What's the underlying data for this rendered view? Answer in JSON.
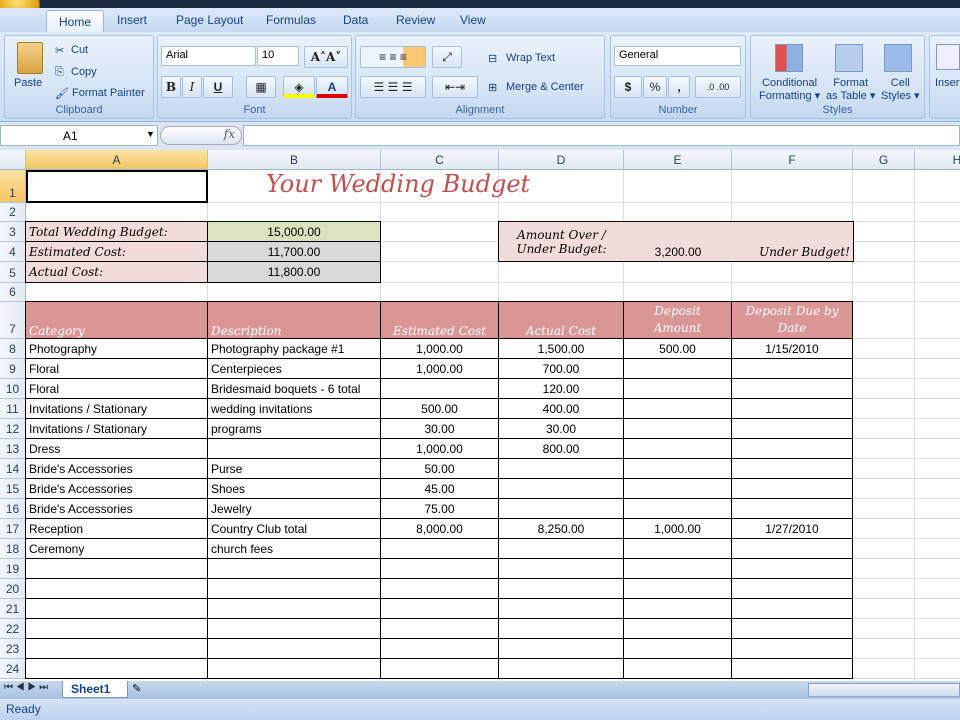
{
  "ribbon": {
    "tabs": [
      "Home",
      "Insert",
      "Page Layout",
      "Formulas",
      "Data",
      "Review",
      "View"
    ],
    "active_tab": "Home",
    "clipboard": {
      "paste": "Paste",
      "cut": "Cut",
      "copy": "Copy",
      "format_painter": "Format Painter",
      "label": "Clipboard"
    },
    "font": {
      "name": "Arial",
      "size": "10",
      "bold": "B",
      "italic": "I",
      "underline": "U",
      "label": "Font",
      "fill_color": "#ffff00",
      "font_color": "#e00000"
    },
    "alignment": {
      "wrap_text": "Wrap Text",
      "merge_center": "Merge & Center",
      "label": "Alignment"
    },
    "number": {
      "format": "General",
      "currency": "$",
      "percent": "%",
      "comma": ",",
      "label": "Number"
    },
    "styles": {
      "conditional": "Conditional",
      "conditional2": "Formatting",
      "format_table": "Format",
      "format_table2": "as Table",
      "cell_styles": "Cell",
      "cell_styles2": "Styles",
      "label": "Styles"
    },
    "cells": {
      "insert": "Insert"
    }
  },
  "formula_bar": {
    "name_box": "A1",
    "fx": "fx",
    "value": ""
  },
  "columns": [
    "A",
    "B",
    "C",
    "D",
    "E",
    "F",
    "G",
    "H"
  ],
  "selected_cell": "A1",
  "sheet": {
    "title": "Your Wedding Budget",
    "summary": [
      {
        "label": "Total Wedding Budget:",
        "value": "15,000.00"
      },
      {
        "label": "Estimated Cost:",
        "value": "11,700.00"
      },
      {
        "label": "Actual Cost:",
        "value": "11,800.00"
      }
    ],
    "over_under": {
      "label1": "Amount Over /",
      "label2": "Under Budget:",
      "value": "3,200.00",
      "status": "Under Budget!"
    },
    "headers": [
      "Category",
      "Description",
      "Estimated Cost",
      "Actual Cost",
      "Deposit Amount",
      "Deposit Due by Date"
    ],
    "headers_split": {
      "e1": "Deposit",
      "e2": "Amount",
      "f1": "Deposit Due by",
      "f2": "Date"
    },
    "rows": [
      [
        "Photography",
        "Photography package #1",
        "1,000.00",
        "1,500.00",
        "500.00",
        "1/15/2010"
      ],
      [
        "Floral",
        "Centerpieces",
        "1,000.00",
        "700.00",
        "",
        ""
      ],
      [
        "Floral",
        "Bridesmaid boquets - 6 total",
        "",
        "120.00",
        "",
        ""
      ],
      [
        "Invitations / Stationary",
        "wedding invitations",
        "500.00",
        "400.00",
        "",
        ""
      ],
      [
        "Invitations / Stationary",
        "programs",
        "30.00",
        "30.00",
        "",
        ""
      ],
      [
        "Dress",
        "",
        "1,000.00",
        "800.00",
        "",
        ""
      ],
      [
        "Bride's Accessories",
        "Purse",
        "50.00",
        "",
        "",
        ""
      ],
      [
        "Bride's Accessories",
        "Shoes",
        "45.00",
        "",
        "",
        ""
      ],
      [
        "Bride's Accessories",
        "Jewelry",
        "75.00",
        "",
        "",
        ""
      ],
      [
        "Reception",
        "Country Club total",
        "8,000.00",
        "8,250.00",
        "1,000.00",
        "1/27/2010"
      ],
      [
        "Ceremony",
        "church fees",
        "",
        "",
        "",
        ""
      ],
      [
        "",
        "",
        "",
        "",
        "",
        ""
      ],
      [
        "",
        "",
        "",
        "",
        "",
        ""
      ],
      [
        "",
        "",
        "",
        "",
        "",
        ""
      ],
      [
        "",
        "",
        "",
        "",
        "",
        ""
      ],
      [
        "",
        "",
        "",
        "",
        "",
        ""
      ],
      [
        "",
        "",
        "",
        "",
        "",
        ""
      ]
    ],
    "colors": {
      "title": "#c0504d",
      "header_fill": "#d99694",
      "label_fill": "#f2dcdb",
      "budget_fill": "#d7e4bc",
      "gray_fill": "#d9d9d9"
    }
  },
  "sheet_tabs": [
    "Sheet1"
  ],
  "status": "Ready"
}
